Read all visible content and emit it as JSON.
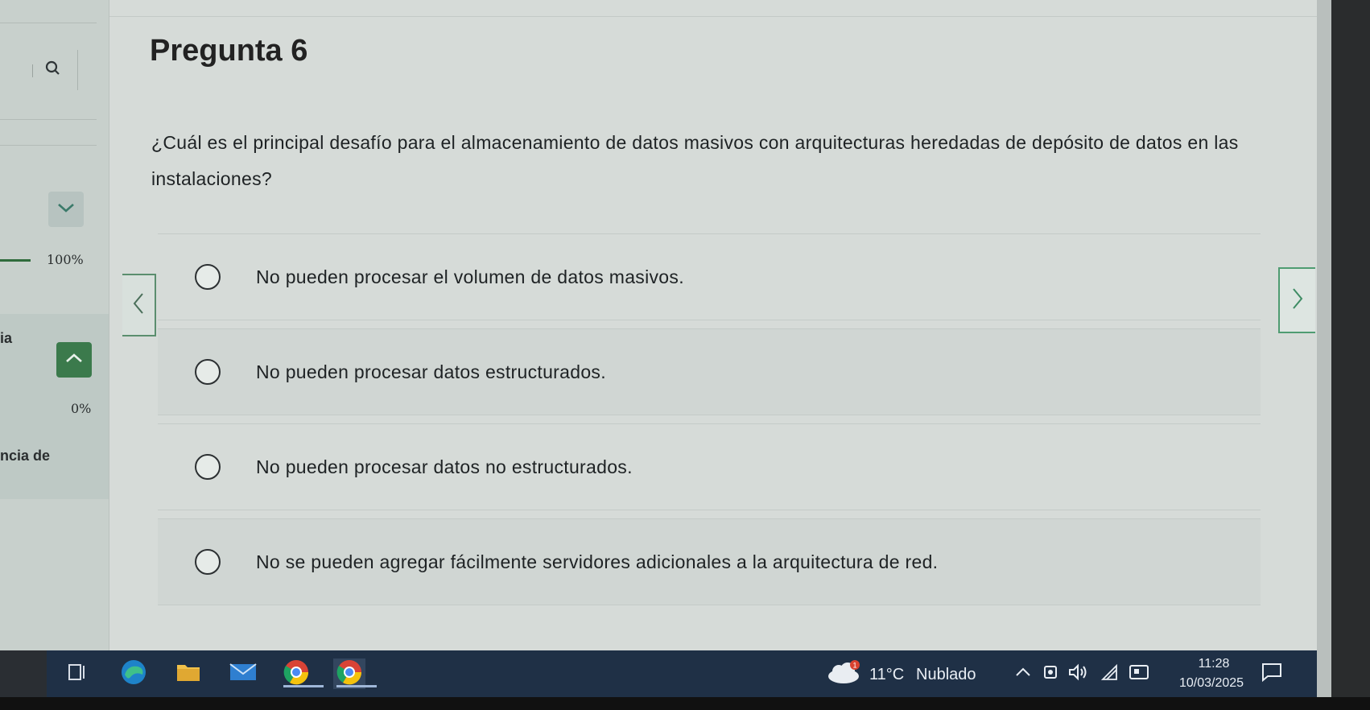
{
  "page": {
    "title": "Pregunta 6",
    "question": "¿Cuál es el principal desafío para el almacenamiento de datos masivos con arquitecturas heredadas de depósito de datos en las instalaciones?",
    "options": [
      {
        "label": "No pueden procesar el volumen de datos masivos."
      },
      {
        "label": "No pueden procesar datos estructurados."
      },
      {
        "label": "No pueden procesar datos no estructurados."
      },
      {
        "label": "No se pueden agregar fácilmente servidores adicionales a la arquitectura de red."
      }
    ]
  },
  "sidebar": {
    "progress_label": "100%",
    "section_title": "ia",
    "progress_zero": "0%",
    "section_title2": "ncia de"
  },
  "taskbar": {
    "weather_temp": "11°C",
    "weather_desc": "Nublado",
    "time": "11:28",
    "date": "10/03/2025",
    "weather_badge": "1"
  },
  "colors": {
    "accent_green": "#3b7a4c",
    "taskbar_bg": "#1f3046"
  }
}
